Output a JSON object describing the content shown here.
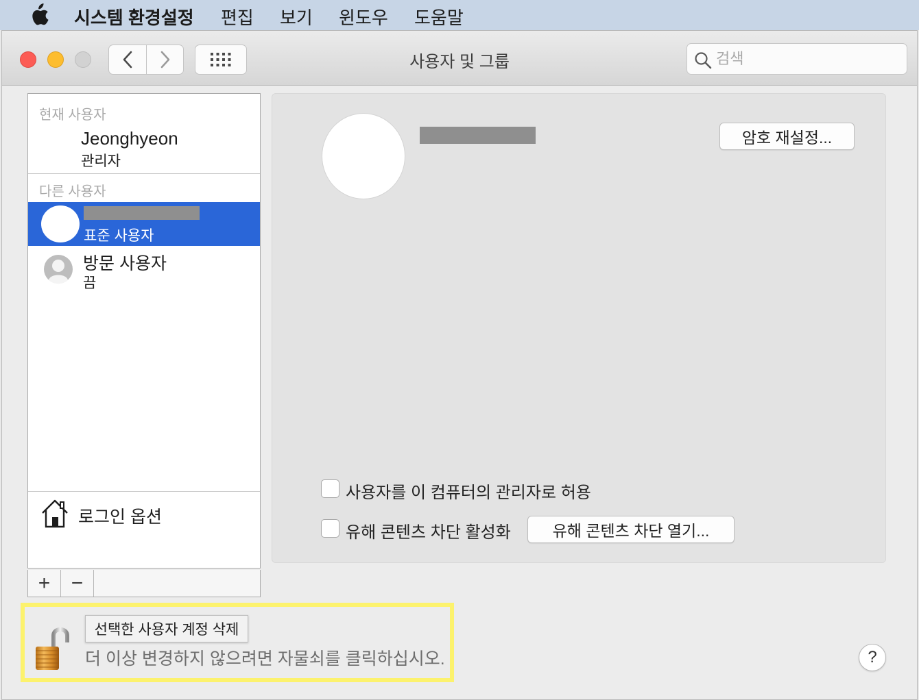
{
  "menubar": {
    "app_name": "시스템 환경설정",
    "items": [
      "편집",
      "보기",
      "윈도우",
      "도움말"
    ]
  },
  "window": {
    "title": "사용자 및 그룹",
    "search_placeholder": "검색"
  },
  "user_list": {
    "current_users_label": "현재 사용자",
    "current_user": {
      "name": "Jeonghyeon",
      "role": "관리자"
    },
    "other_users_label": "다른 사용자",
    "selected_user": {
      "role": "표준 사용자"
    },
    "guest_user": {
      "name": "방문 사용자",
      "status": "끔"
    },
    "login_options_label": "로그인 옵션",
    "add_label": "+",
    "remove_label": "−"
  },
  "detail": {
    "reset_password_label": "암호 재설정...",
    "allow_admin_label": "사용자를 이 컴퓨터의 관리자로 허용",
    "allow_admin_checked": false,
    "parental_controls_label": "유해 콘텐츠 차단 활성화",
    "parental_controls_checked": false,
    "open_parental_controls_label": "유해 콘텐츠 차단 열기..."
  },
  "footer": {
    "tooltip": "선택한 사용자 계정 삭제",
    "lock_message": "더 이상 변경하지 않으려면 자물쇠를 클릭하십시오.",
    "help_label": "?"
  },
  "colors": {
    "selection": "#2a66d8",
    "highlight_box": "#fcf26d",
    "redaction": "#8f8f8f"
  },
  "icons": [
    "apple-logo-icon",
    "back-chevron-icon",
    "forward-chevron-icon",
    "grid-icon",
    "search-icon",
    "guest-avatar-icon",
    "house-icon",
    "open-lock-icon"
  ]
}
